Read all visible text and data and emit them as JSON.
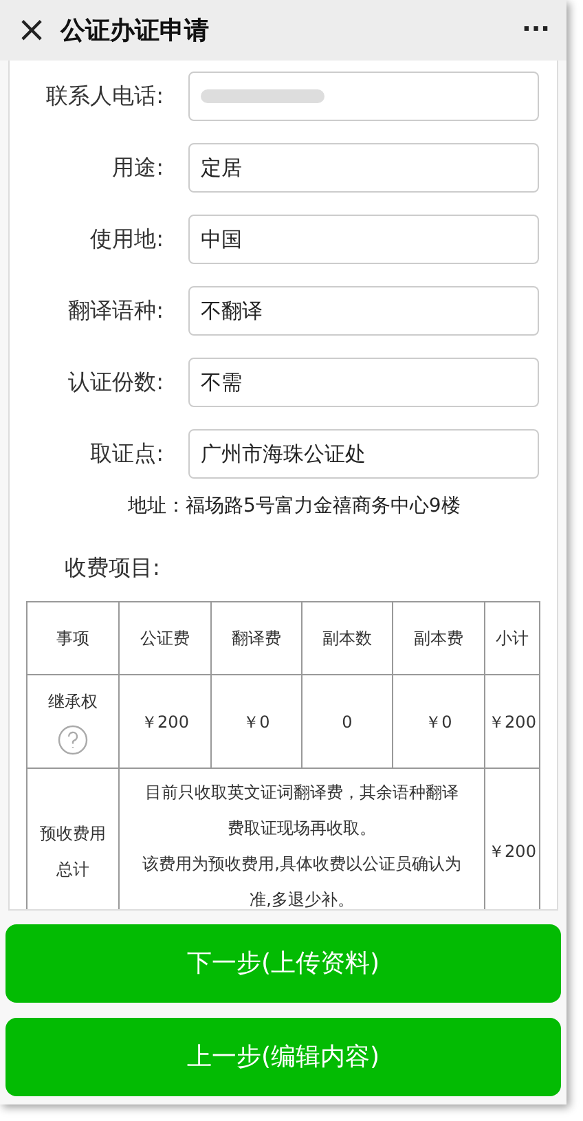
{
  "header": {
    "title": "公证办证申请",
    "close_icon": "×",
    "more": "···"
  },
  "fields": [
    {
      "kind": "redacted",
      "label": "联系人电话:"
    },
    {
      "kind": "text",
      "label": "用途:",
      "value": "定居"
    },
    {
      "kind": "text",
      "label": "使用地:",
      "value": "中国"
    },
    {
      "kind": "text",
      "label": "翻译语种:",
      "value": "不翻译"
    },
    {
      "kind": "text",
      "label": "认证份数:",
      "value": "不需"
    },
    {
      "kind": "text",
      "label": "取证点:",
      "value": "广州市海珠公证处"
    }
  ],
  "address": "地址：福场路5号富力金禧商务中心9楼",
  "fees_title": "收费项目:",
  "table": {
    "columns": [
      "事项",
      "公证费",
      "翻译费",
      "副本数",
      "副本费",
      "小计"
    ],
    "rows": [
      {
        "cells": [
          "继承权",
          "￥200",
          "￥0",
          "0",
          "￥0",
          "￥200"
        ],
        "help": true
      }
    ],
    "total": {
      "label": "预收费用总计",
      "notes": [
        "目前只收取英文证词翻译费，其余语种翻译费取证现场再收取。",
        "该费用为预收费用,具体收费以公证员确认为准,多退少补。"
      ],
      "amount": "￥200"
    }
  },
  "buttons": [
    "下一步(上传资料)",
    "上一步(编辑内容)"
  ]
}
